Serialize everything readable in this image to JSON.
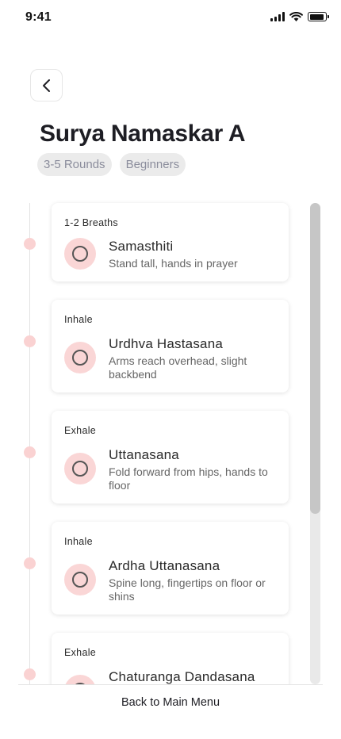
{
  "status_bar": {
    "time": "9:41",
    "battery_level": 0.9
  },
  "header": {
    "back_icon": "chevron-left-icon",
    "title": "Surya Namaskar A"
  },
  "chips": [
    "3-5 Rounds",
    "Beginners"
  ],
  "steps": [
    {
      "phase": "1-2 Breaths",
      "name": "Samasthiti",
      "description": "Stand tall, hands in prayer"
    },
    {
      "phase": "Inhale",
      "name": "Urdhva Hastasana",
      "description": "Arms reach overhead, slight backbend"
    },
    {
      "phase": "Exhale",
      "name": "Uttanasana",
      "description": "Fold forward from hips, hands to floor"
    },
    {
      "phase": "Inhale",
      "name": "Ardha Uttanasana",
      "description": "Spine long, fingertips on floor or shins"
    },
    {
      "phase": "Exhale",
      "name": "Chaturanga Dandasana",
      "description": ""
    }
  ],
  "footer": {
    "back_label": "Back to Main Menu"
  },
  "colors": {
    "accent_soft": "#fad6d6",
    "chip_bg": "#ebebeb",
    "chip_text": "#8b8d9c",
    "title": "#1e1e24"
  }
}
